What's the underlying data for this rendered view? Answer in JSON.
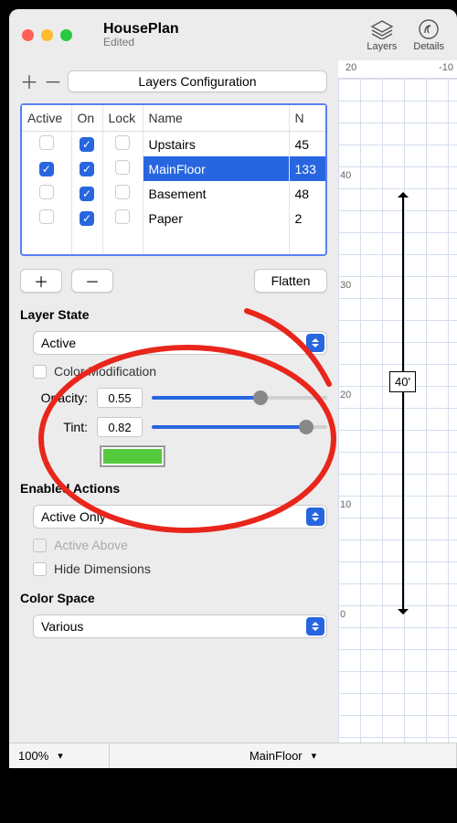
{
  "window": {
    "title": "HousePlan",
    "subtitle": "Edited"
  },
  "toolbar": {
    "layers_label": "Layers",
    "details_label": "Details",
    "config_button": "Layers Configuration",
    "flatten_button": "Flatten",
    "plus": "＋",
    "minus": "－"
  },
  "table": {
    "headers": {
      "active": "Active",
      "on": "On",
      "lock": "Lock",
      "name": "Name",
      "n": "N"
    },
    "rows": [
      {
        "active": false,
        "on": true,
        "lock": false,
        "name": "Upstairs",
        "n": "45",
        "selected": false
      },
      {
        "active": true,
        "on": true,
        "lock": false,
        "name": "MainFloor",
        "n": "133",
        "selected": true
      },
      {
        "active": false,
        "on": true,
        "lock": false,
        "name": "Basement",
        "n": "48",
        "selected": false
      },
      {
        "active": false,
        "on": true,
        "lock": false,
        "name": "Paper",
        "n": "2",
        "selected": false
      }
    ]
  },
  "layer_state": {
    "heading": "Layer State",
    "select_value": "Active",
    "color_mod_label": "Color Modification",
    "opacity_label": "Opacity:",
    "opacity_value": "0.55",
    "opacity_pct": 62,
    "tint_label": "Tint:",
    "tint_value": "0.82",
    "tint_pct": 88,
    "swatch_color": "#54c93c"
  },
  "enabled_actions": {
    "heading": "Enabled Actions",
    "select_value": "Active Only",
    "active_above_label": "Active Above",
    "hide_dims_label": "Hide Dimensions"
  },
  "color_space": {
    "heading": "Color Space",
    "select_value": "Various"
  },
  "footer": {
    "zoom": "100%",
    "layer": "MainFloor"
  },
  "canvas": {
    "ruler_top": [
      "20",
      "-10"
    ],
    "ruler_side": [
      "40",
      "30",
      "20",
      "10",
      "0"
    ],
    "dimension_label": "40'"
  }
}
